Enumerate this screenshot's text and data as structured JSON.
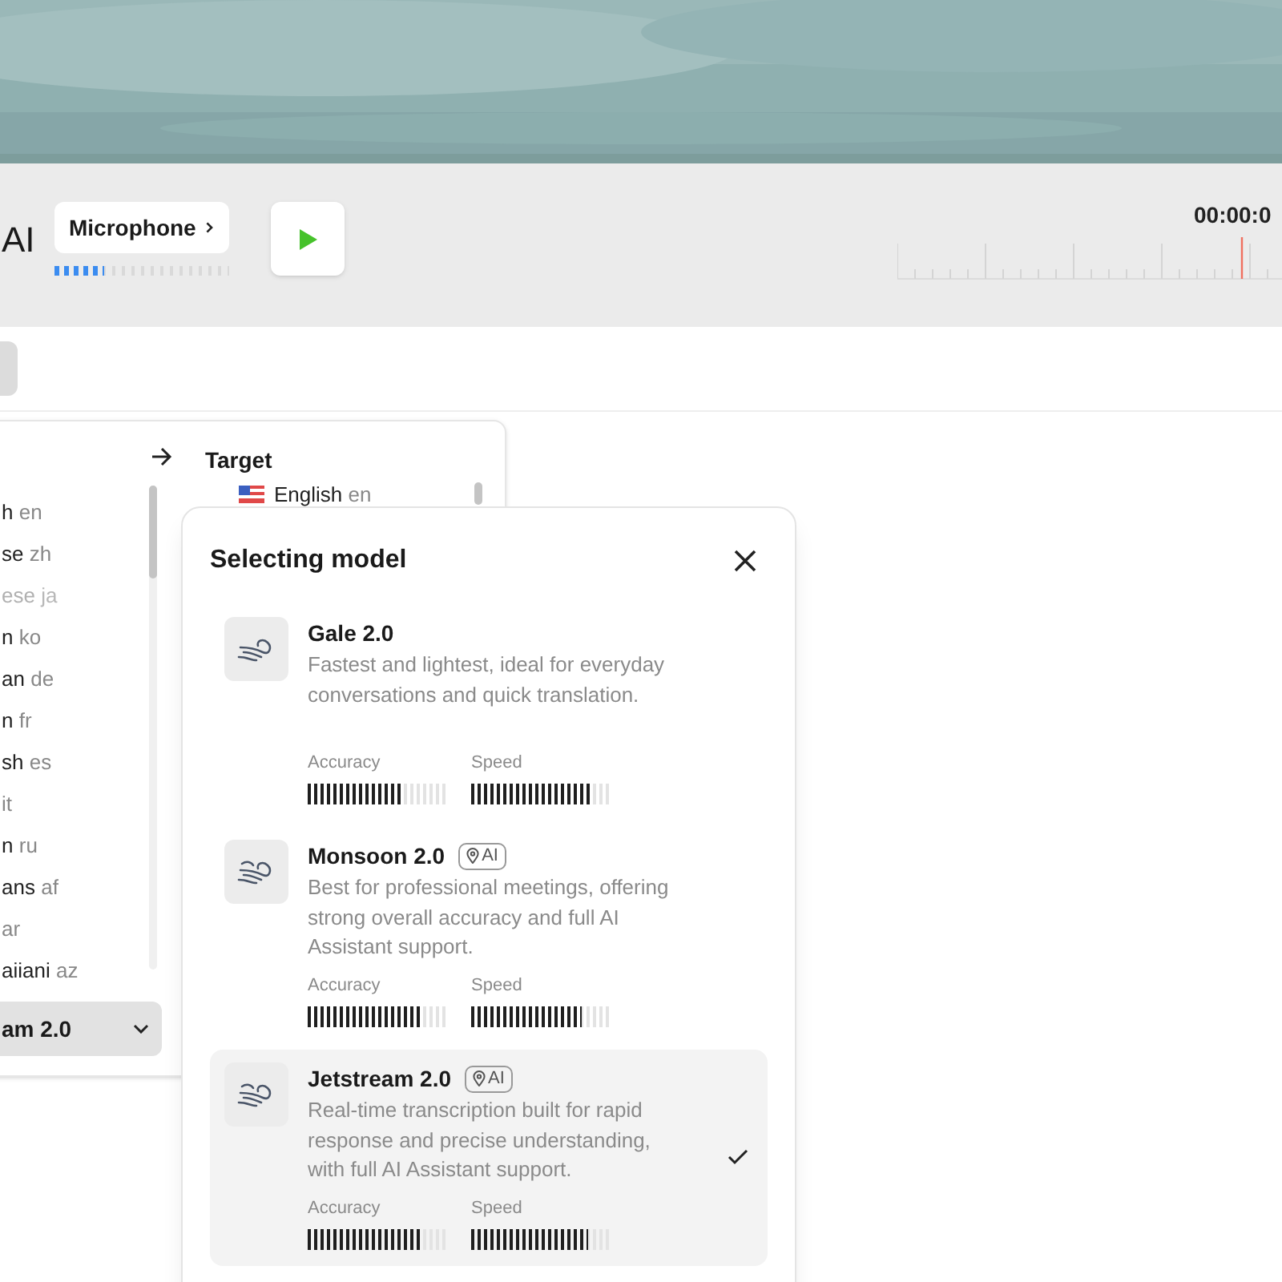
{
  "toolbar": {
    "title": "AI",
    "microphone": {
      "label": "Microphone",
      "level": 0.28
    },
    "timer": "00:00:0"
  },
  "language_panel": {
    "target_label": "Target",
    "source_languages": [
      {
        "name": "h",
        "code": "en",
        "disabled": false
      },
      {
        "name": "se",
        "code": "zh",
        "disabled": false
      },
      {
        "name": "ese",
        "code": "ja",
        "disabled": true
      },
      {
        "name": "n",
        "code": "ko",
        "disabled": false
      },
      {
        "name": "an",
        "code": "de",
        "disabled": false
      },
      {
        "name": "n",
        "code": "fr",
        "disabled": false
      },
      {
        "name": "sh",
        "code": "es",
        "disabled": false
      },
      {
        "code": "it",
        "disabled": false
      },
      {
        "name": "n",
        "code": "ru",
        "disabled": false
      },
      {
        "name": "ans",
        "code": "af",
        "disabled": false
      },
      {
        "code": "ar",
        "disabled": false
      },
      {
        "name": "aiiani",
        "code": "az",
        "disabled": false
      }
    ],
    "target_languages": [
      {
        "name": "English",
        "code": "en"
      }
    ],
    "model_dropdown": "am 2.0"
  },
  "model_dialog": {
    "title": "Selecting model",
    "models": [
      {
        "name": "Gale 2.0",
        "ai": false,
        "description": "Fastest and lightest, ideal for everyday conversations and quick translation.",
        "selected": false,
        "accuracy_label": "Accuracy",
        "speed_label": "Speed",
        "accuracy": {
          "level": 0.7
        },
        "speed": {
          "level": 0.88
        }
      },
      {
        "name": "Monsoon 2.0",
        "ai": true,
        "badge": "AI",
        "description": "Best for professional meetings, offering strong overall accuracy and full AI Assistant support.",
        "selected": false,
        "accuracy_label": "Accuracy",
        "speed_label": "Speed",
        "accuracy": {
          "level": 0.82
        },
        "speed": {
          "level": 0.8
        }
      },
      {
        "name": "Jetstream 2.0",
        "ai": true,
        "badge": "AI",
        "description": "Real-time transcription built for rapid response and precise understanding, with full AI Assistant support.",
        "selected": true,
        "accuracy_label": "Accuracy",
        "speed_label": "Speed",
        "accuracy": {
          "level": 0.82
        },
        "speed": {
          "level": 0.85
        }
      }
    ]
  }
}
